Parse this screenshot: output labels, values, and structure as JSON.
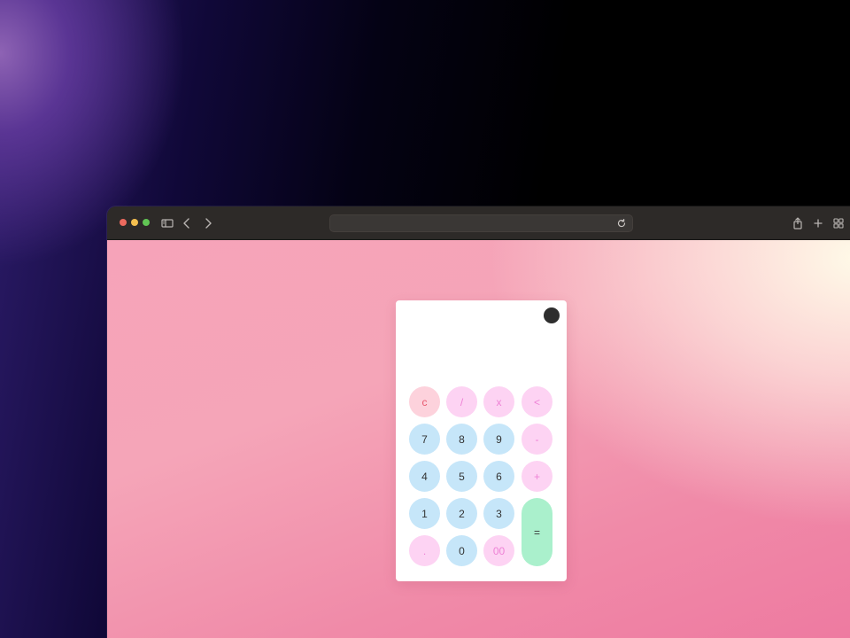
{
  "browser": {
    "url": "",
    "toolbar_icons": [
      "sidebar-icon",
      "back-icon",
      "forward-icon",
      "reload-icon",
      "share-icon",
      "new-tab-icon",
      "tab-overview-icon"
    ]
  },
  "calculator": {
    "display_value": "",
    "theme_toggle_color": "#2e2e2e",
    "keys": {
      "clear": "c",
      "divide": "/",
      "multiply": "x",
      "backspace": "<",
      "seven": "7",
      "eight": "8",
      "nine": "9",
      "minus": "-",
      "four": "4",
      "five": "5",
      "six": "6",
      "plus": "+",
      "one": "1",
      "two": "2",
      "three": "3",
      "equals": "=",
      "decimal": ".",
      "zero": "0",
      "double_zero": "00"
    },
    "colors": {
      "number_key": "#c6e6f9",
      "operator_key": "#fdd3f3",
      "clear_key": "#fdd2dc",
      "equals_key": "#aaf0cc"
    }
  }
}
